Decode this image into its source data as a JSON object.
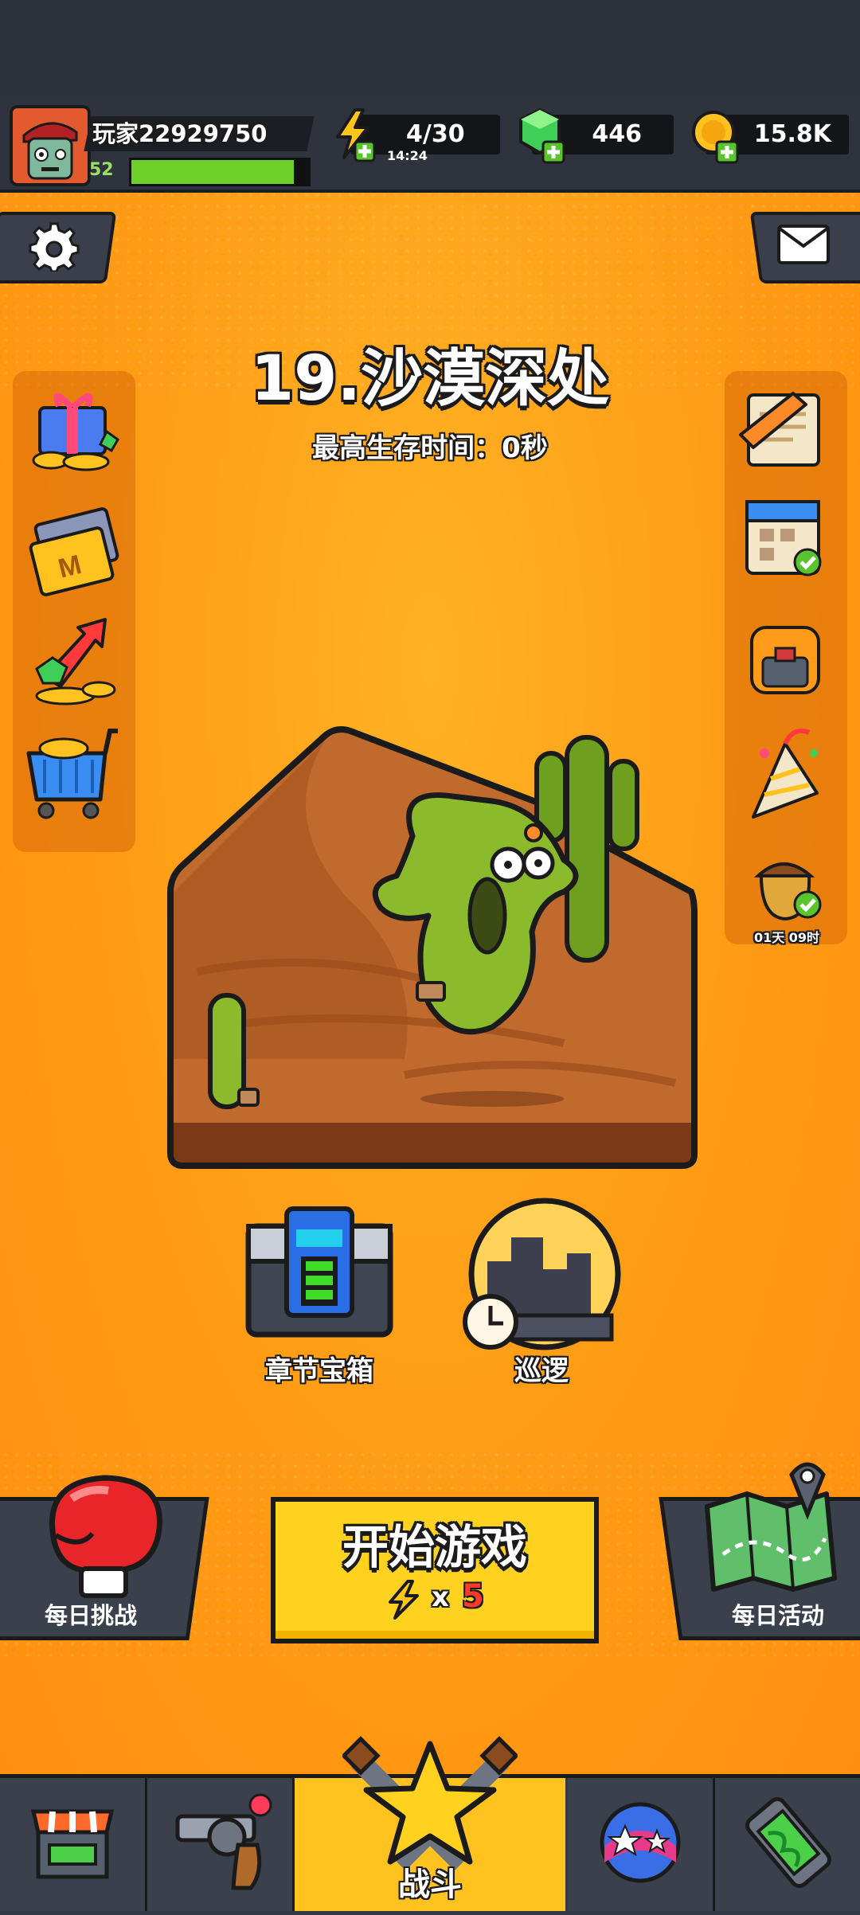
{
  "player": {
    "name": "玩家22929750",
    "level": "52",
    "xp_fraction": 0.92
  },
  "resources": {
    "energy": "4/30",
    "energy_timer": "14:24",
    "gems": "446",
    "coins": "15.8K"
  },
  "stage": {
    "title": "19.沙漠深处",
    "best_time": "最高生存时间：0秒"
  },
  "right_panel": {
    "acorn_timer": "01天 09时"
  },
  "center_buttons": {
    "chest_label": "章节宝箱",
    "patrol_label": "巡逻"
  },
  "start": {
    "label": "开始游戏",
    "cost_prefix": "x",
    "cost_value": "5"
  },
  "side_buttons": {
    "daily_challenge": "每日挑战",
    "daily_event": "每日活动"
  },
  "nav": {
    "battle_label": "战斗"
  },
  "colors": {
    "background": "#ff9a1a",
    "header": "#2f333e",
    "start_button": "#ffd21f",
    "xp_bar": "#6ed12a",
    "cactus": "#8bbb2c",
    "desert": "#b8612a"
  }
}
